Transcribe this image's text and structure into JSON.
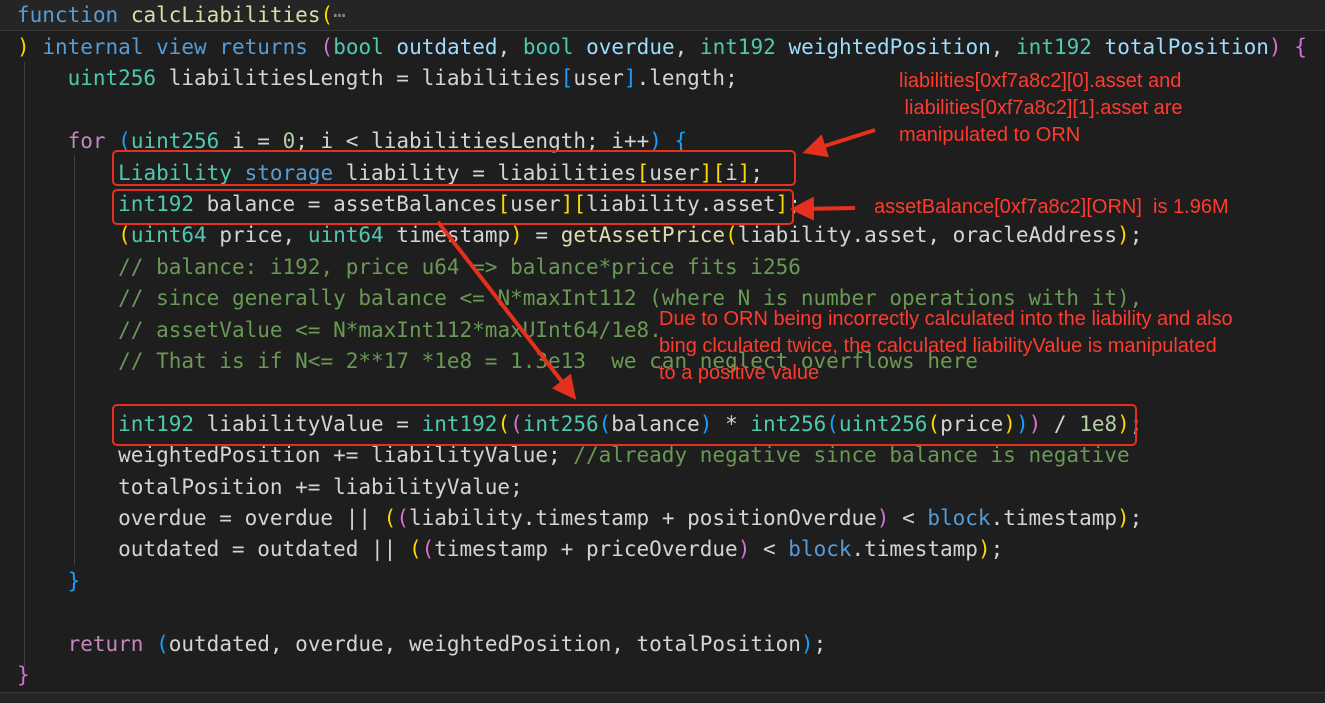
{
  "colors": {
    "background": "#1e1e1e",
    "annotation": "#ff3b2f",
    "highlight_box": "#e5301e"
  },
  "code": {
    "lines": [
      [
        [
          "kw",
          "function"
        ],
        [
          "p",
          " "
        ],
        [
          "fn",
          "calcLiabilities"
        ],
        [
          "b1",
          "("
        ],
        [
          "dim",
          "⋯"
        ]
      ],
      [
        [
          "b1",
          ")"
        ],
        [
          "p",
          " "
        ],
        [
          "kw",
          "internal"
        ],
        [
          "p",
          " "
        ],
        [
          "kw",
          "view"
        ],
        [
          "p",
          " "
        ],
        [
          "kw",
          "returns"
        ],
        [
          "p",
          " "
        ],
        [
          "b2",
          "("
        ],
        [
          "type",
          "bool"
        ],
        [
          "p",
          " "
        ],
        [
          "var",
          "outdated"
        ],
        [
          "p",
          ", "
        ],
        [
          "type",
          "bool"
        ],
        [
          "p",
          " "
        ],
        [
          "var",
          "overdue"
        ],
        [
          "p",
          ", "
        ],
        [
          "type",
          "int192"
        ],
        [
          "p",
          " "
        ],
        [
          "var",
          "weightedPosition"
        ],
        [
          "p",
          ", "
        ],
        [
          "type",
          "int192"
        ],
        [
          "p",
          " "
        ],
        [
          "var",
          "totalPosition"
        ],
        [
          "b2",
          ")"
        ],
        [
          "p",
          " "
        ],
        [
          "b2",
          "{"
        ]
      ],
      [
        [
          "p",
          "    "
        ],
        [
          "type",
          "uint256"
        ],
        [
          "p",
          " liabilitiesLength = liabilities"
        ],
        [
          "b3",
          "["
        ],
        [
          "p",
          "user"
        ],
        [
          "b3",
          "]"
        ],
        [
          "p",
          ".length;"
        ]
      ],
      [],
      [
        [
          "p",
          "    "
        ],
        [
          "ctl",
          "for"
        ],
        [
          "p",
          " "
        ],
        [
          "b3",
          "("
        ],
        [
          "type",
          "uint256"
        ],
        [
          "p",
          " i = "
        ],
        [
          "num",
          "0"
        ],
        [
          "p",
          "; i < liabilitiesLength; i++"
        ],
        [
          "b3",
          ")"
        ],
        [
          "p",
          " "
        ],
        [
          "b3",
          "{"
        ]
      ],
      [
        [
          "p",
          "        "
        ],
        [
          "type",
          "Liability"
        ],
        [
          "p",
          " "
        ],
        [
          "kw",
          "storage"
        ],
        [
          "p",
          " liability = liabilities"
        ],
        [
          "b1",
          "["
        ],
        [
          "p",
          "user"
        ],
        [
          "b1",
          "]"
        ],
        [
          "b1",
          "["
        ],
        [
          "p",
          "i"
        ],
        [
          "b1",
          "]"
        ],
        [
          "p",
          ";"
        ]
      ],
      [
        [
          "p",
          "        "
        ],
        [
          "type",
          "int192"
        ],
        [
          "p",
          " balance = assetBalances"
        ],
        [
          "b1",
          "["
        ],
        [
          "p",
          "user"
        ],
        [
          "b1",
          "]"
        ],
        [
          "b1",
          "["
        ],
        [
          "p",
          "liability.asset"
        ],
        [
          "b1",
          "]"
        ],
        [
          "p",
          ";"
        ]
      ],
      [
        [
          "p",
          "        "
        ],
        [
          "b1",
          "("
        ],
        [
          "type",
          "uint64"
        ],
        [
          "p",
          " price, "
        ],
        [
          "type",
          "uint64"
        ],
        [
          "p",
          " timestamp"
        ],
        [
          "b1",
          ")"
        ],
        [
          "p",
          " = "
        ],
        [
          "fn",
          "getAssetPrice"
        ],
        [
          "b1",
          "("
        ],
        [
          "p",
          "liability.asset, oracleAddress"
        ],
        [
          "b1",
          ")"
        ],
        [
          "p",
          ";"
        ]
      ],
      [
        [
          "p",
          "        "
        ],
        [
          "com",
          "// balance: i192, price u64 => balance*price fits i256"
        ]
      ],
      [
        [
          "p",
          "        "
        ],
        [
          "com",
          "// since generally balance <= N*maxInt112 (where N is number operations with it),"
        ]
      ],
      [
        [
          "p",
          "        "
        ],
        [
          "com",
          "// assetValue <= N*maxInt112*maxUInt64/1e8."
        ]
      ],
      [
        [
          "p",
          "        "
        ],
        [
          "com",
          "// That is if N<= 2**17 *1e8 = 1.3e13  we can neglect overflows here"
        ]
      ],
      [],
      [
        [
          "p",
          "        "
        ],
        [
          "type",
          "int192"
        ],
        [
          "p",
          " liabilityValue = "
        ],
        [
          "type",
          "int192"
        ],
        [
          "b1",
          "("
        ],
        [
          "b2",
          "("
        ],
        [
          "type",
          "int256"
        ],
        [
          "b3",
          "("
        ],
        [
          "p",
          "balance"
        ],
        [
          "b3",
          ")"
        ],
        [
          "p",
          " * "
        ],
        [
          "type",
          "int256"
        ],
        [
          "b3",
          "("
        ],
        [
          "type",
          "uint256"
        ],
        [
          "b1",
          "("
        ],
        [
          "p",
          "price"
        ],
        [
          "b1",
          ")"
        ],
        [
          "b3",
          ")"
        ],
        [
          "b2",
          ")"
        ],
        [
          "p",
          " / "
        ],
        [
          "num",
          "1e8"
        ],
        [
          "b1",
          ")"
        ],
        [
          "p",
          ";"
        ]
      ],
      [
        [
          "p",
          "        weightedPosition += liabilityValue; "
        ],
        [
          "com",
          "//already negative since balance is negative"
        ]
      ],
      [
        [
          "p",
          "        totalPosition += liabilityValue;"
        ]
      ],
      [
        [
          "p",
          "        overdue = overdue || "
        ],
        [
          "b1",
          "("
        ],
        [
          "b2",
          "("
        ],
        [
          "p",
          "liability.timestamp + positionOverdue"
        ],
        [
          "b2",
          ")"
        ],
        [
          "p",
          " < "
        ],
        [
          "kw",
          "block"
        ],
        [
          "p",
          ".timestamp"
        ],
        [
          "b1",
          ")"
        ],
        [
          "p",
          ";"
        ]
      ],
      [
        [
          "p",
          "        outdated = outdated || "
        ],
        [
          "b1",
          "("
        ],
        [
          "b2",
          "("
        ],
        [
          "p",
          "timestamp + priceOverdue"
        ],
        [
          "b2",
          ")"
        ],
        [
          "p",
          " < "
        ],
        [
          "kw",
          "block"
        ],
        [
          "p",
          ".timestamp"
        ],
        [
          "b1",
          ")"
        ],
        [
          "p",
          ";"
        ]
      ],
      [
        [
          "p",
          "    "
        ],
        [
          "b3",
          "}"
        ]
      ],
      [],
      [
        [
          "p",
          "    "
        ],
        [
          "ctl",
          "return"
        ],
        [
          "p",
          " "
        ],
        [
          "b3",
          "("
        ],
        [
          "p",
          "outdated, overdue, weightedPosition, totalPosition"
        ],
        [
          "b3",
          ")"
        ],
        [
          "p",
          ";"
        ]
      ],
      [
        [
          "b2",
          "}"
        ]
      ]
    ]
  },
  "annotations": {
    "liability_assets": "liabilities[0xf7a8c2][0].asset and\n liabilities[0xf7a8c2][1].asset are\nmanipulated to ORN",
    "asset_balance": "assetBalance[0xf7a8c2][ORN]  is 1.96M",
    "liability_value": "Due to ORN being incorrectly calculated into the liability and also\nbing clculated twice, the calculated liabilityValue is manipulated\nto a positive value"
  }
}
